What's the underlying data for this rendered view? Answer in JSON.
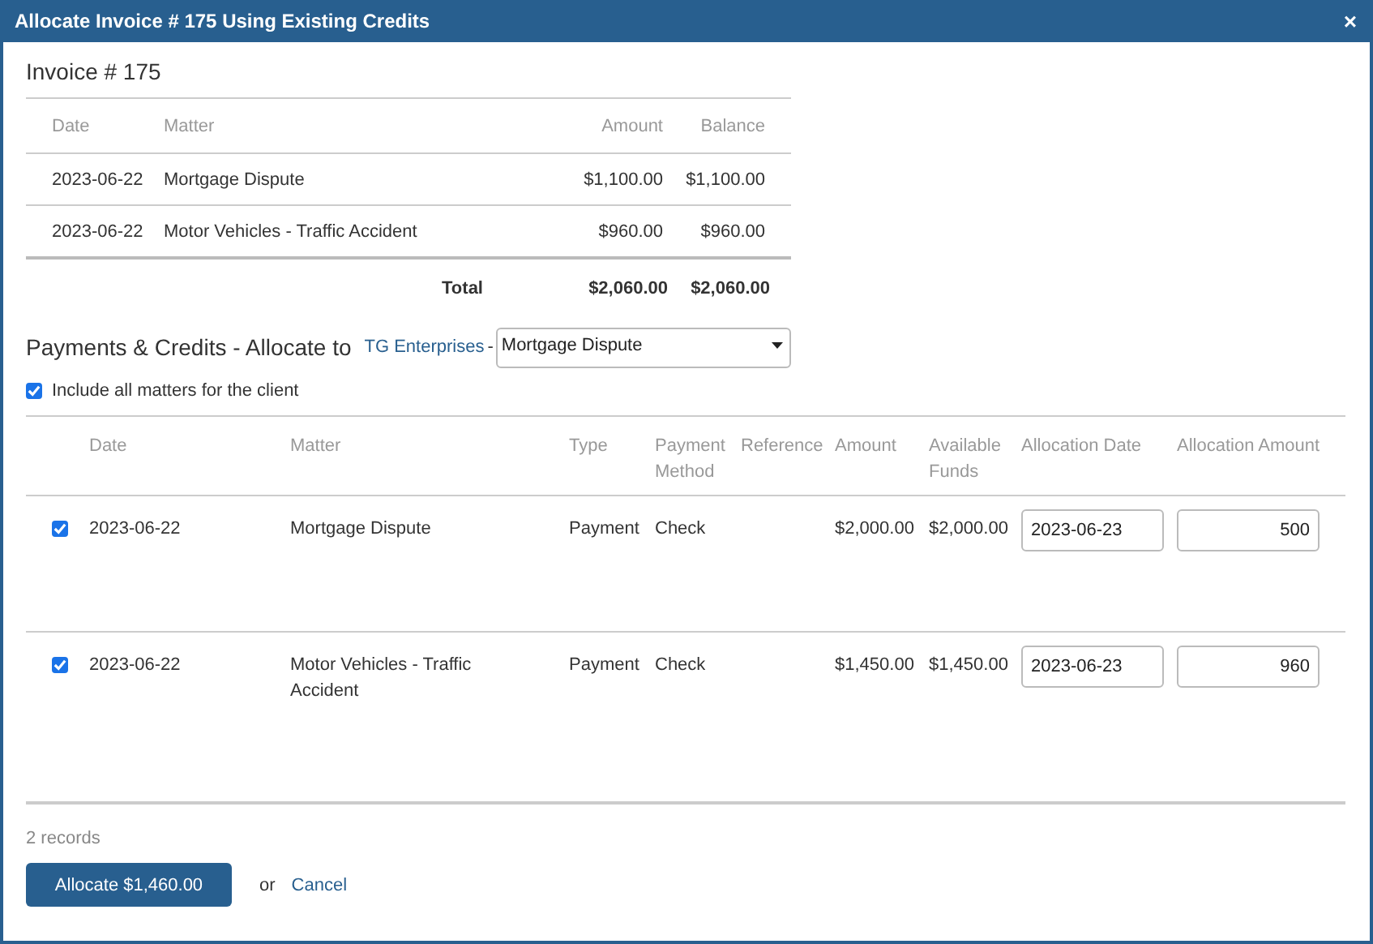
{
  "window": {
    "title": "Allocate Invoice # 175 Using Existing Credits",
    "close": "×"
  },
  "invoice": {
    "heading": "Invoice # 175",
    "columns": [
      "Date",
      "Matter",
      "Amount",
      "Balance"
    ],
    "rows": [
      {
        "date": "2023-06-22",
        "matter": "Mortgage Dispute",
        "amount": "$1,100.00",
        "balance": "$1,100.00"
      },
      {
        "date": "2023-06-22",
        "matter": "Motor Vehicles - Traffic Accident",
        "amount": "$960.00",
        "balance": "$960.00"
      }
    ],
    "total": {
      "label": "Total",
      "amount": "$2,060.00",
      "balance": "$2,060.00"
    }
  },
  "allocate_to": {
    "heading": "Payments & Credits - Allocate to",
    "client": "TG Enterprises",
    "separator": "-",
    "matter_select": "Mortgage Dispute"
  },
  "include_all": {
    "label": "Include all matters for the client",
    "checked": true
  },
  "payments": {
    "columns": [
      "Date",
      "Matter",
      "Type",
      "Payment Method",
      "Reference",
      "Amount",
      "Available Funds",
      "Allocation Date",
      "Allocation Amount"
    ],
    "rows": [
      {
        "checked": true,
        "date": "2023-06-22",
        "matter": "Mortgage Dispute",
        "type": "Payment",
        "method": "Check",
        "amount": "$2,000.00",
        "available": "$2,000.00",
        "allocation_date": "2023-06-23",
        "allocation_amount": "500"
      },
      {
        "checked": true,
        "date": "2023-06-22",
        "matter": "Motor Vehicles - Traffic Accident",
        "type": "Payment",
        "method": "Check",
        "amount": "$1,450.00",
        "available": "$1,450.00",
        "allocation_date": "2023-06-23",
        "allocation_amount": "960"
      }
    ]
  },
  "records": "2 records",
  "allocate_button": "Allocate $1,460.00",
  "or": "or",
  "cancel": "Cancel"
}
